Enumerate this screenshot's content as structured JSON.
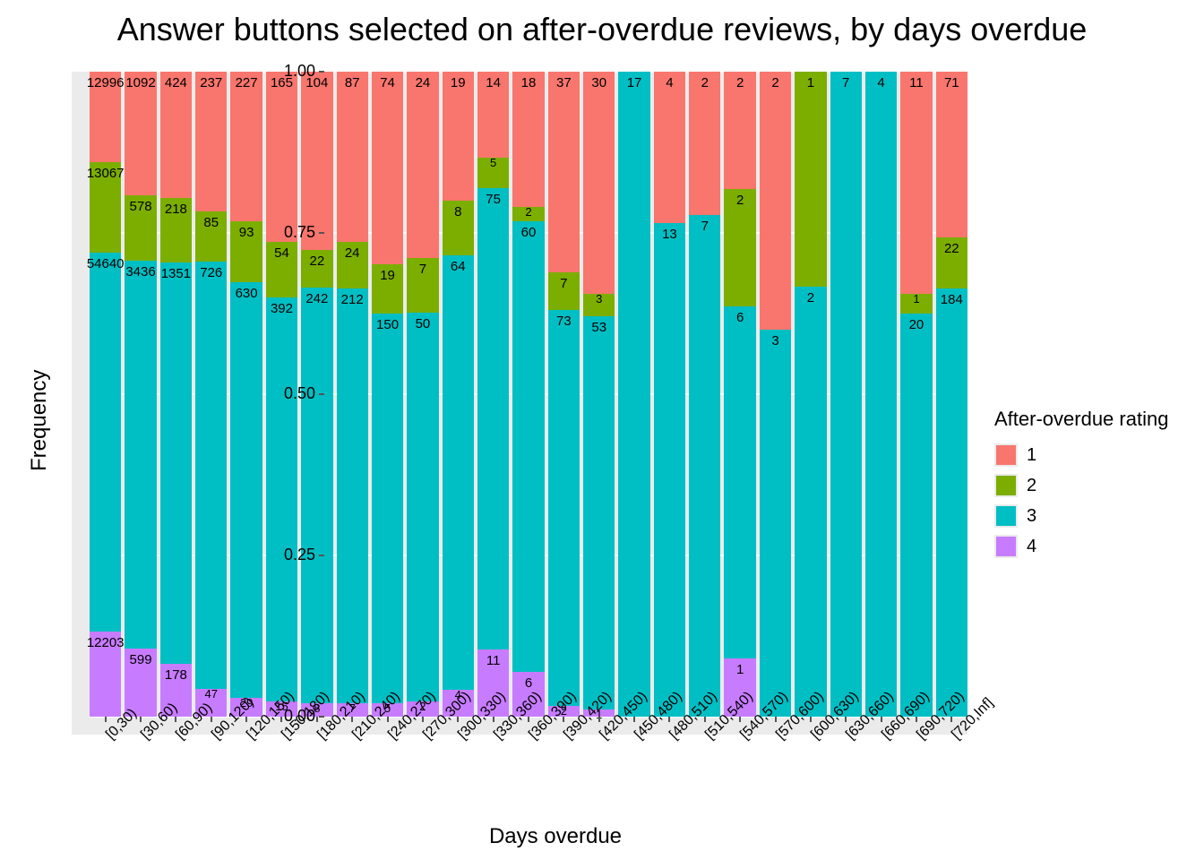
{
  "title": "Answer buttons selected on after-overdue reviews, by days overdue",
  "ylabel": "Frequency",
  "xlabel": "Days overdue",
  "legend_title": "After-overdue rating",
  "colors": {
    "1": "#f8766d",
    "2": "#7cae00",
    "3": "#00bfc4",
    "4": "#c77cff"
  },
  "legend_items": [
    {
      "key": "1",
      "label": "1"
    },
    {
      "key": "2",
      "label": "2"
    },
    {
      "key": "3",
      "label": "3"
    },
    {
      "key": "4",
      "label": "4"
    }
  ],
  "yticks": [
    {
      "v": 0.0,
      "label": "0.00"
    },
    {
      "v": 0.25,
      "label": "0.25"
    },
    {
      "v": 0.5,
      "label": "0.50"
    },
    {
      "v": 0.75,
      "label": "0.75"
    },
    {
      "v": 1.0,
      "label": "1.00"
    }
  ],
  "chart_data": {
    "type": "bar",
    "stacked": true,
    "normalized": true,
    "ylim": [
      0,
      1
    ],
    "xlabel": "Days overdue",
    "ylabel": "Frequency",
    "title": "Answer buttons selected on after-overdue reviews, by days overdue",
    "series_order_bottom_to_top": [
      "4",
      "3",
      "2",
      "1"
    ],
    "categories": [
      "[0,30)",
      "[30,60)",
      "[60,90)",
      "[90,120)",
      "[120,150)",
      "[150,180)",
      "[180,210)",
      "[210,240)",
      "[240,270)",
      "[270,300)",
      "[300,330)",
      "[330,360)",
      "[360,390)",
      "[390,420)",
      "[420,450)",
      "[450,480)",
      "[480,510)",
      "[510,540)",
      "[540,570)",
      "[570,600)",
      "[600,630)",
      "[630,660)",
      "[660,690)",
      "[690,720)",
      "[720,Inf]"
    ],
    "counts": [
      {
        "1": 12996,
        "2": 13067,
        "3": 54640,
        "4": 12203
      },
      {
        "1": 1092,
        "2": 578,
        "3": 3436,
        "4": 599
      },
      {
        "1": 424,
        "2": 218,
        "3": 1351,
        "4": 178
      },
      {
        "1": 237,
        "2": 85,
        "3": 726,
        "4": 47
      },
      {
        "1": 227,
        "2": 93,
        "3": 630,
        "4": 29
      },
      {
        "1": 165,
        "2": 54,
        "3": 392,
        "4": 15
      },
      {
        "1": 104,
        "2": 22,
        "3": 242,
        "4": 8
      },
      {
        "1": 87,
        "2": 24,
        "3": 212,
        "4": 7
      },
      {
        "1": 74,
        "2": 19,
        "3": 150,
        "4": 5
      },
      {
        "1": 24,
        "2": 7,
        "3": 50,
        "4": 2
      },
      {
        "1": 19,
        "2": 8,
        "3": 64,
        "4": 4
      },
      {
        "1": 14,
        "2": 5,
        "3": 75,
        "4": 11
      },
      {
        "1": 18,
        "2": 2,
        "3": 60,
        "4": 6
      },
      {
        "1": 37,
        "2": 7,
        "3": 73,
        "4": 2
      },
      {
        "1": 30,
        "2": 3,
        "3": 53,
        "4": 1
      },
      {
        "1": 0,
        "2": 0,
        "3": 17,
        "4": 0
      },
      {
        "1": 4,
        "2": 0,
        "3": 13,
        "4": 0
      },
      {
        "1": 2,
        "2": 0,
        "3": 7,
        "4": 0
      },
      {
        "1": 2,
        "2": 2,
        "3": 6,
        "4": 1
      },
      {
        "1": 2,
        "2": 0,
        "3": 3,
        "4": 0
      },
      {
        "1": 0,
        "2": 1,
        "3": 2,
        "4": 0
      },
      {
        "1": 0,
        "2": 0,
        "3": 7,
        "4": 0
      },
      {
        "1": 0,
        "2": 0,
        "3": 4,
        "4": 0
      },
      {
        "1": 11,
        "2": 1,
        "3": 20,
        "4": 0
      },
      {
        "1": 71,
        "2": 22,
        "3": 184,
        "4": 0
      }
    ]
  }
}
